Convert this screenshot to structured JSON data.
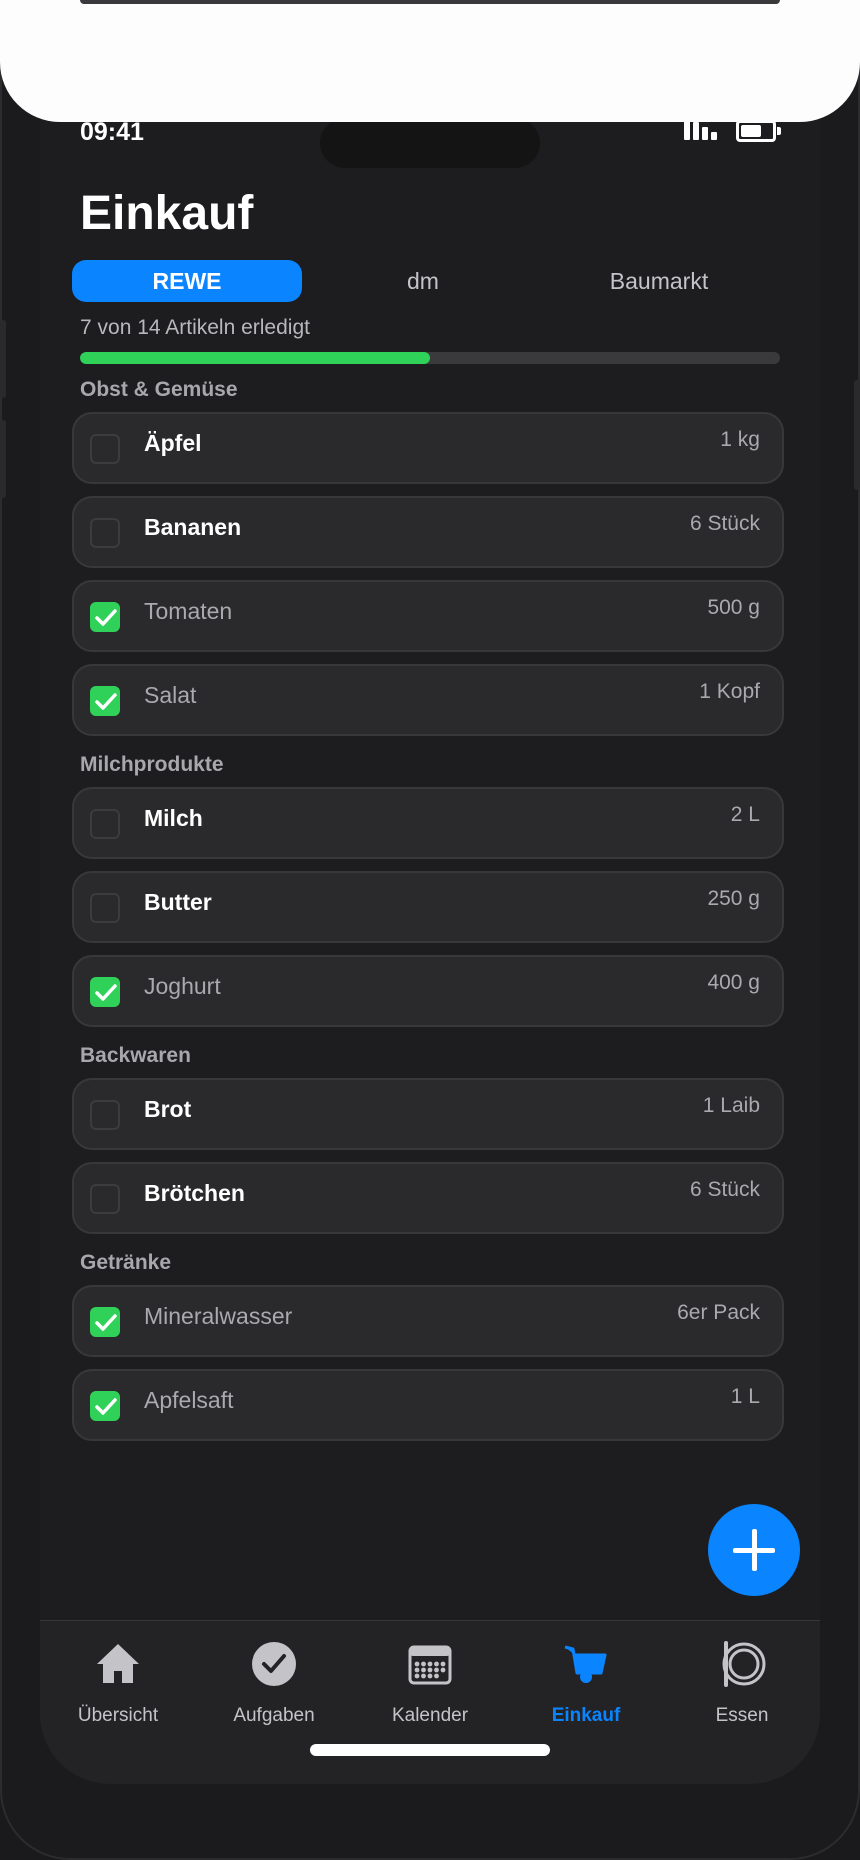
{
  "status_bar": {
    "time": "09:41"
  },
  "header": {
    "title": "Einkauf"
  },
  "stores": [
    {
      "label": "REWE",
      "active": true
    },
    {
      "label": "dm",
      "active": false
    },
    {
      "label": "Baumarkt",
      "active": false
    }
  ],
  "progress": {
    "label": "7 von 14 Artikeln erledigt",
    "done": 7,
    "total": 14,
    "fraction": 0.5,
    "color": "#30d158"
  },
  "sections": [
    {
      "title": "Obst & Gemüse",
      "items": [
        {
          "name": "Äpfel",
          "qty": "1 kg",
          "done": false
        },
        {
          "name": "Bananen",
          "qty": "6 Stück",
          "done": false
        },
        {
          "name": "Tomaten",
          "qty": "500 g",
          "done": true
        },
        {
          "name": "Salat",
          "qty": "1 Kopf",
          "done": true
        }
      ]
    },
    {
      "title": "Milchprodukte",
      "items": [
        {
          "name": "Milch",
          "qty": "2 L",
          "done": false
        },
        {
          "name": "Butter",
          "qty": "250 g",
          "done": false
        },
        {
          "name": "Joghurt",
          "qty": "400 g",
          "done": true
        }
      ]
    },
    {
      "title": "Backwaren",
      "items": [
        {
          "name": "Brot",
          "qty": "1 Laib",
          "done": false
        },
        {
          "name": "Brötchen",
          "qty": "6 Stück",
          "done": false
        }
      ]
    },
    {
      "title": "Getränke",
      "items": [
        {
          "name": "Mineralwasser",
          "qty": "6er Pack",
          "done": true
        },
        {
          "name": "Apfelsaft",
          "qty": "1 L",
          "done": true
        }
      ]
    }
  ],
  "fab": {
    "icon": "plus-icon"
  },
  "tab_bar": [
    {
      "label": "Übersicht",
      "icon": "home-icon",
      "active": false
    },
    {
      "label": "Aufgaben",
      "icon": "checkmark-circle-icon",
      "active": false
    },
    {
      "label": "Kalender",
      "icon": "calendar-icon",
      "active": false
    },
    {
      "label": "Einkauf",
      "icon": "cart-icon",
      "active": true
    },
    {
      "label": "Essen",
      "icon": "plate-icon",
      "active": false
    }
  ],
  "colors": {
    "accent": "#0a84ff",
    "success": "#30d158",
    "background": "#1d1d1f",
    "card": "#2a2a2c"
  }
}
